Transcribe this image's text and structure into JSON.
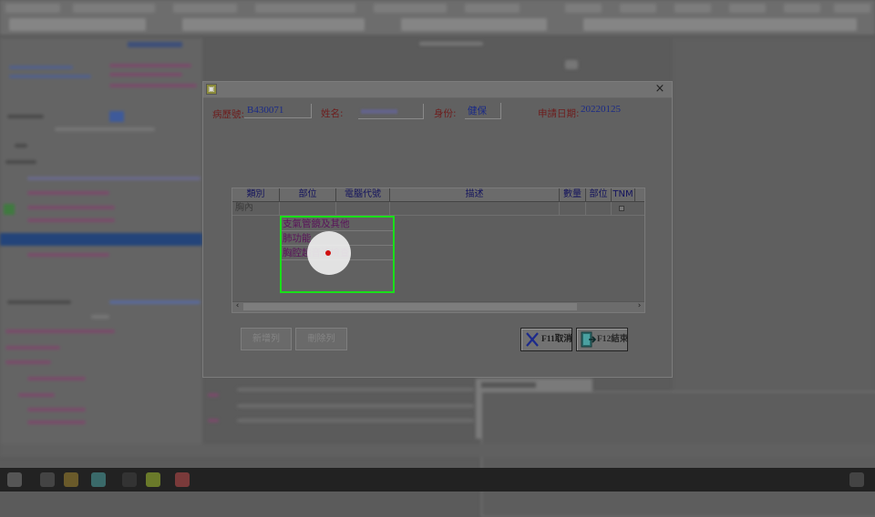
{
  "dialog": {
    "fields": {
      "record_no_label": "病歷號:",
      "record_no_value": "B430071",
      "name_label": "姓名:",
      "identity_label": "身份:",
      "identity_value": "健保",
      "apply_date_label": "申請日期:",
      "apply_date_value": "20220125"
    },
    "grid": {
      "headers": [
        "類別",
        "部位",
        "電腦代號",
        "描述",
        "數量",
        "部位",
        "TNM"
      ],
      "rows": [
        {
          "category": "胸內",
          "part": "",
          "code": "",
          "description": "",
          "quantity": "",
          "part2": "",
          "tnm_checked": false
        }
      ]
    },
    "dropdown": {
      "items": [
        "支氣管鏡及其他",
        "肺功能",
        "胸腔超音波檢查"
      ]
    },
    "buttons": {
      "add_row": "新增列",
      "delete_row": "刪除列",
      "cancel": "F11取消",
      "finish": "F12結束"
    }
  },
  "colors": {
    "highlight_border": "#19e019",
    "label_color": "#6d1d1d",
    "value_color": "#1a2a86"
  },
  "icons": [
    "window-icon",
    "close-icon",
    "cancel-x-icon",
    "exit-door-icon"
  ]
}
